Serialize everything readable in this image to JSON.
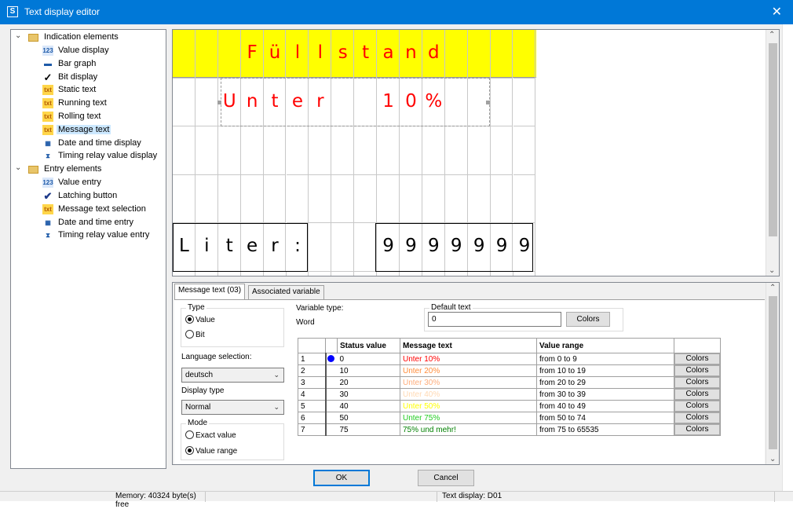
{
  "window": {
    "title": "Text display editor",
    "close_glyph": "✕",
    "app_icon": "S"
  },
  "tree": {
    "groups": [
      {
        "label": "Indication elements",
        "icon": "folder-icon",
        "items": [
          {
            "label": "Value display",
            "icon": "value-display-icon"
          },
          {
            "label": "Bar graph",
            "icon": "bar-graph-icon"
          },
          {
            "label": "Bit display",
            "icon": "checkmark-icon"
          },
          {
            "label": "Static text",
            "icon": "static-text-icon"
          },
          {
            "label": "Running text",
            "icon": "running-text-icon"
          },
          {
            "label": "Rolling text",
            "icon": "rolling-text-icon"
          },
          {
            "label": "Message text",
            "icon": "message-text-icon",
            "selected": true
          },
          {
            "label": "Date and time display",
            "icon": "date-time-icon"
          },
          {
            "label": "Timing relay value display",
            "icon": "timing-relay-icon"
          }
        ]
      },
      {
        "label": "Entry elements",
        "icon": "folder-icon",
        "items": [
          {
            "label": "Value entry",
            "icon": "value-entry-icon"
          },
          {
            "label": "Latching button",
            "icon": "latching-button-icon"
          },
          {
            "label": "Message text selection",
            "icon": "message-text-selection-icon"
          },
          {
            "label": "Date and time entry",
            "icon": "date-time-entry-icon"
          },
          {
            "label": "Timing relay value entry",
            "icon": "timing-relay-entry-icon"
          }
        ]
      }
    ]
  },
  "display": {
    "rows": [
      {
        "chars": [
          "",
          "",
          "",
          "F",
          "ü",
          "l",
          "l",
          "s",
          "t",
          "a",
          "n",
          "d",
          "",
          "",
          "",
          ""
        ],
        "color": "#ff0000"
      },
      {
        "chars": [
          "",
          "",
          "U",
          "n",
          "t",
          "e",
          "r",
          "",
          "",
          "1",
          "0",
          "%",
          "",
          "",
          "",
          ""
        ],
        "color": "#ff0000"
      },
      {
        "chars": [
          "",
          "",
          "",
          "",
          "",
          "",
          "",
          "",
          "",
          "",
          "",
          "",
          "",
          "",
          "",
          ""
        ],
        "color": "#000000"
      },
      {
        "chars": [
          "",
          "",
          "",
          "",
          "",
          "",
          "",
          "",
          "",
          "",
          "",
          "",
          "",
          "",
          "",
          ""
        ],
        "color": "#000000"
      },
      {
        "chars": [
          "L",
          "i",
          "t",
          "e",
          "r",
          ":",
          "",
          "",
          "",
          "9",
          "9",
          "9",
          "9",
          "9",
          "9",
          "9"
        ],
        "color": "#000000"
      }
    ],
    "highlight_color": "#ffff00"
  },
  "props": {
    "tabs": [
      {
        "label": "Message text (03)",
        "active": true
      },
      {
        "label": "Associated variable",
        "active": false
      }
    ],
    "type": {
      "title": "Type",
      "options": [
        {
          "label": "Value",
          "checked": true
        },
        {
          "label": "Bit",
          "checked": false
        }
      ]
    },
    "variable_type": {
      "label": "Variable type:",
      "value": "Word"
    },
    "default_text": {
      "title": "Default text",
      "value": "0",
      "colors_button": "Colors"
    },
    "language": {
      "label": "Language selection:",
      "value": "deutsch"
    },
    "display_type": {
      "label": "Display type",
      "value": "Normal"
    },
    "mode": {
      "title": "Mode",
      "options": [
        {
          "label": "Exact value",
          "checked": false
        },
        {
          "label": "Value range",
          "checked": true
        }
      ]
    },
    "table": {
      "headers": [
        "Status value",
        "Message text",
        "Value range"
      ],
      "rows": [
        {
          "num": "1",
          "status": "0",
          "message": "Unter 10%",
          "color": "#ff0000",
          "range": "from 0 to 9",
          "button": "Colors",
          "marked": true
        },
        {
          "num": "2",
          "status": "10",
          "message": "Unter 20%",
          "color": "#ff8c3a",
          "range": "from 10 to 19",
          "button": "Colors"
        },
        {
          "num": "3",
          "status": "20",
          "message": "Unter 30%",
          "color": "#ffad7a",
          "range": "from 20 to 29",
          "button": "Colors"
        },
        {
          "num": "4",
          "status": "30",
          "message": "Unter 40%",
          "color": "#ffd9b3",
          "range": "from 30 to 39",
          "button": "Colors"
        },
        {
          "num": "5",
          "status": "40",
          "message": "Unter 50%",
          "color": "#ffff00",
          "range": "from 40 to 49",
          "button": "Colors"
        },
        {
          "num": "6",
          "status": "50",
          "message": "Unter 75%",
          "color": "#22cc22",
          "range": "from 50 to 74",
          "button": "Colors"
        },
        {
          "num": "7",
          "status": "75",
          "message": "75% und mehr!",
          "color": "#008000",
          "range": "from 75 to 65535",
          "button": "Colors"
        }
      ]
    }
  },
  "buttons": {
    "ok": "OK",
    "cancel": "Cancel"
  },
  "status": {
    "memory": "Memory: 40324 byte(s) free",
    "display": "Text display: D01"
  }
}
